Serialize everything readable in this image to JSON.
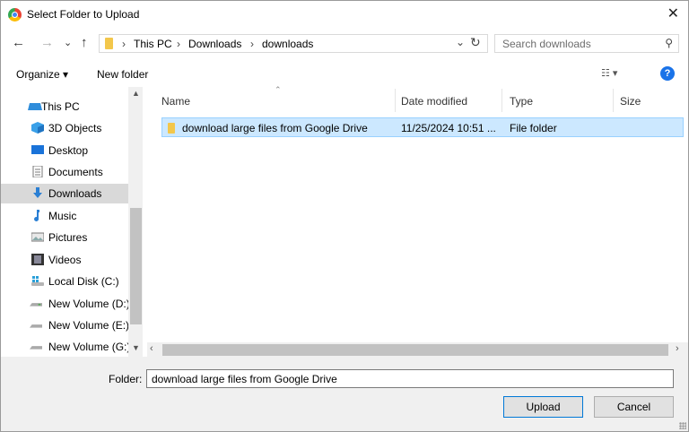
{
  "window": {
    "title": "Select Folder to Upload"
  },
  "nav": {
    "breadcrumb": [
      "This PC",
      "Downloads",
      "downloads"
    ],
    "search_placeholder": "Search downloads"
  },
  "toolbar": {
    "organize_label": "Organize ▾",
    "new_folder_label": "New folder"
  },
  "sidebar": {
    "items": [
      {
        "label": "This PC",
        "icon": "pc-icon"
      },
      {
        "label": "3D Objects",
        "icon": "cube-icon"
      },
      {
        "label": "Desktop",
        "icon": "desktop-icon"
      },
      {
        "label": "Documents",
        "icon": "document-icon"
      },
      {
        "label": "Downloads",
        "icon": "download-arrow-icon",
        "selected": true
      },
      {
        "label": "Music",
        "icon": "music-note-icon"
      },
      {
        "label": "Pictures",
        "icon": "picture-icon"
      },
      {
        "label": "Videos",
        "icon": "film-icon"
      },
      {
        "label": "Local Disk (C:)",
        "icon": "windows-drive-icon"
      },
      {
        "label": "New Volume (D:)",
        "icon": "drive-icon"
      },
      {
        "label": "New Volume (E:)",
        "icon": "drive-icon"
      },
      {
        "label": "New Volume (G:)",
        "icon": "drive-icon"
      }
    ]
  },
  "file_list": {
    "columns": [
      "Name",
      "Date modified",
      "Type",
      "Size"
    ],
    "rows": [
      {
        "name": "download large files from Google Drive",
        "date_modified": "11/25/2024 10:51 ...",
        "type": "File folder",
        "size": ""
      }
    ]
  },
  "footer": {
    "folder_label": "Folder:",
    "folder_value": "download large files from Google Drive",
    "upload_label": "Upload",
    "cancel_label": "Cancel"
  },
  "colors": {
    "selection": "#cce8ff",
    "selection_border": "#99d1ff",
    "accent": "#0078d7",
    "folder": "#f3c74b"
  }
}
